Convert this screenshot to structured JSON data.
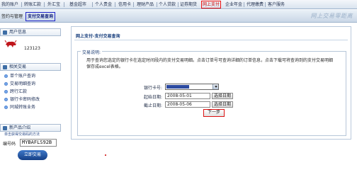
{
  "topnav": {
    "items": [
      {
        "label": "我的账户"
      },
      {
        "label": "转账汇款"
      },
      {
        "label": "外汇宝"
      },
      {
        "label": "基金超市"
      },
      {
        "label": "个人贵金"
      },
      {
        "label": "信用卡"
      },
      {
        "label": "理财产品"
      },
      {
        "label": "个人贷款"
      },
      {
        "label": "证券期货"
      },
      {
        "label": "网上支付",
        "active": true
      },
      {
        "label": "企业年金"
      },
      {
        "label": "代理缴费"
      },
      {
        "label": "客户服务"
      }
    ]
  },
  "subnav": {
    "items": [
      {
        "label": "签约与管理"
      },
      {
        "label": "支付交易查询",
        "active": true
      }
    ],
    "banner": "网上交易零距离"
  },
  "sidebar": {
    "user_header": "用户信息",
    "user_id": "123123",
    "related_header": "相关交易",
    "menu": [
      "单个账户查询",
      "交易明细查询",
      "跨行汇款",
      "银行卡密码修改",
      "同城转账业务"
    ],
    "new_products_header": "新产品介绍",
    "promo_link": "单击获得交易码的方法",
    "code_label": "编号码",
    "code_value": "MYBAFLS92B",
    "apply_button": "立即交易"
  },
  "main": {
    "title": "网上支付-支付交易查询",
    "legend": "交易说明:",
    "description": "用于查询您选定的银行卡在选定时间段内的支付交易明细。点击订单号可查询详细的订单信息，点击下载可将查询到的支付交易明细保存成excel表格。",
    "form": {
      "card_label": "银行卡号:",
      "start_label": "起始日期:",
      "start_value": "2008-05-01",
      "end_label": "截止日期:",
      "end_value": "2008-05-06",
      "choose_date": "选择日期",
      "next_button": "下一步"
    }
  }
}
